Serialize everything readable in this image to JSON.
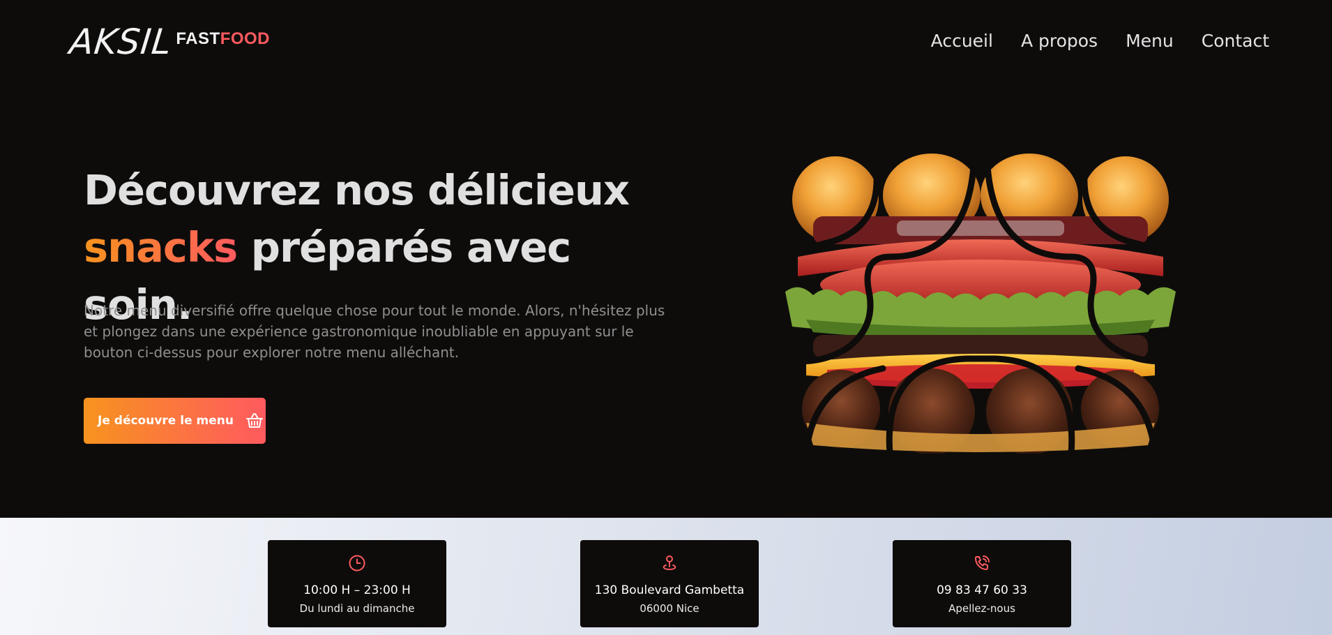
{
  "brand": {
    "main": "AKSIL",
    "fast": "FAST",
    "food": "FOOD",
    "accent_color": "#ff5a5f",
    "gradient_start": "#f7931e"
  },
  "nav": {
    "items": [
      "Accueil",
      "A propos",
      "Menu",
      "Contact"
    ]
  },
  "hero": {
    "title_line1": "Découvrez nos délicieux",
    "title_accent": "snacks",
    "title_rest": " préparés avec soin.",
    "description": "Notre menu diversifié offre quelque chose pour tout le monde. Alors, n'hésitez plus et plongez dans une expérience gastronomique inoubliable en appuyant sur le bouton ci-dessus pour explorer notre menu alléchant.",
    "cta_label": "Je découvre le menu",
    "cta_icon": "basket-icon"
  },
  "info": {
    "hours": {
      "icon": "clock-icon",
      "title": "10:00 H – 23:00 H",
      "subtitle": "Du lundi au dimanche"
    },
    "address": {
      "icon": "location-pin-icon",
      "title": "130 Boulevard Gambetta",
      "subtitle": "06000 Nice"
    },
    "phone": {
      "icon": "phone-ringing-icon",
      "title": "09 83 47 60 33",
      "subtitle": "Apellez-nous"
    }
  }
}
